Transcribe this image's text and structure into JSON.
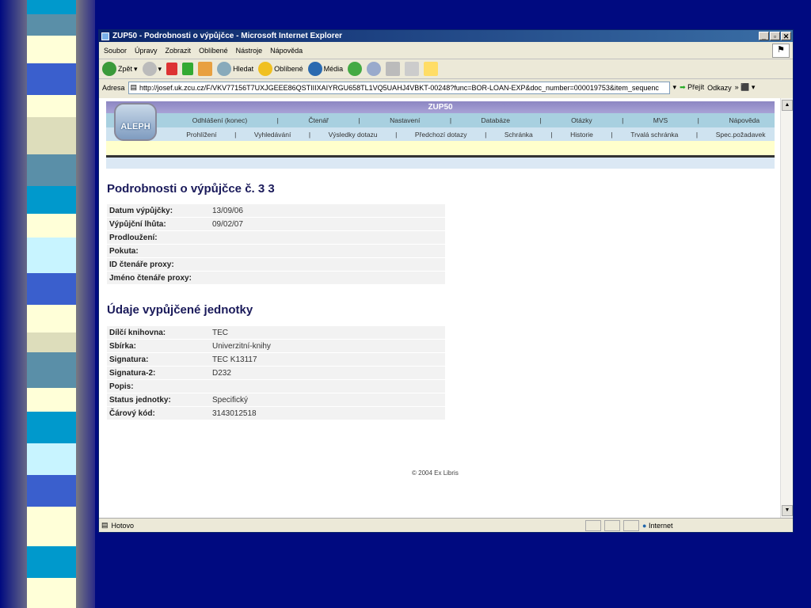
{
  "window": {
    "title": "ZUP50 - Podrobnosti o výpůjčce - Microsoft Internet Explorer",
    "buttons": [
      "_",
      "▫",
      "✕"
    ]
  },
  "menu": [
    "Soubor",
    "Úpravy",
    "Zobrazit",
    "Oblíbené",
    "Nástroje",
    "Nápověda"
  ],
  "toolbar": {
    "back": "Zpět",
    "search": "Hledat",
    "favorites": "Oblíbené",
    "media": "Média"
  },
  "address": {
    "label": "Adresa",
    "url": "http://josef.uk.zcu.cz/F/VKV77156T7UXJGEEE86QSTIIIXAIYRGU658TL1VQ5UAHJ4VBKT-00248?func=BOR-LOAN-EXP&doc_number=000019753&item_sequenc",
    "go": "Přejít",
    "links": "Odkazy"
  },
  "header": {
    "title": "ZUP50",
    "logo": "ALEPH",
    "row1": [
      "Odhlášení (konec)",
      "Čtenář",
      "Nastavení",
      "Databáze",
      "Otázky",
      "MVS",
      "Nápověda"
    ],
    "row2": [
      "Prohlížení",
      "Vyhledávání",
      "Výsledky dotazu",
      "Předchozí dotazy",
      "Schránka",
      "Historie",
      "Trvalá schránka",
      "Spec.požadavek"
    ]
  },
  "loan": {
    "heading": "Podrobnosti o výpůjčce č. 3      3",
    "rows": [
      {
        "label": "Datum výpůjčky:",
        "value": "13/09/06"
      },
      {
        "label": "Výpůjční lhůta:",
        "value": "09/02/07"
      },
      {
        "label": "Prodloužení:",
        "value": ""
      },
      {
        "label": "Pokuta:",
        "value": ""
      },
      {
        "label": "ID čtenáře proxy:",
        "value": ""
      },
      {
        "label": "Jméno čtenáře proxy:",
        "value": ""
      }
    ]
  },
  "item": {
    "heading": "Údaje vypůjčené jednotky",
    "rows": [
      {
        "label": "Dílčí knihovna:",
        "value": "TEC"
      },
      {
        "label": "Sbírka:",
        "value": "Univerzitní-knihy"
      },
      {
        "label": "Signatura:",
        "value": "TEC K13117"
      },
      {
        "label": "Signatura-2:",
        "value": "D232"
      },
      {
        "label": "Popis:",
        "value": ""
      },
      {
        "label": "Status jednotky:",
        "value": "Specifický"
      },
      {
        "label": "Čárový kód:",
        "value": "3143012518"
      }
    ]
  },
  "footer": "© 2004 Ex Libris",
  "status": {
    "text": "Hotovo",
    "zone": "Internet"
  }
}
